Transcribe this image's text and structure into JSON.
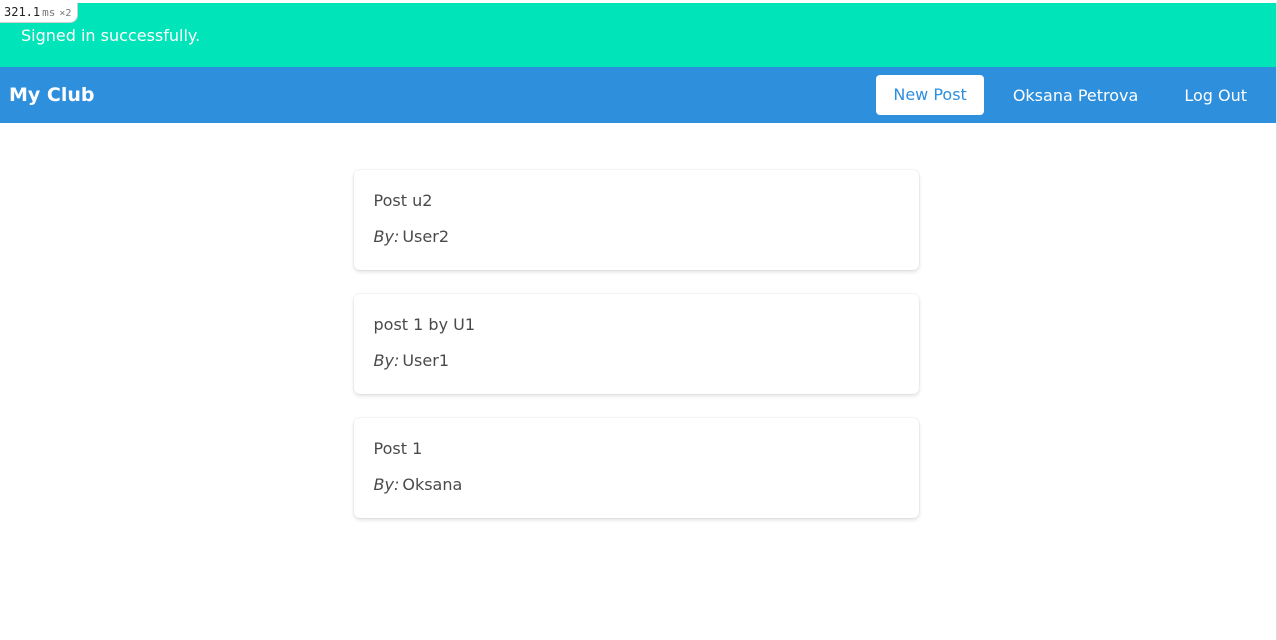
{
  "perf_badge": {
    "value": "321.1",
    "unit": "ms",
    "multiplier": "×2"
  },
  "flash": {
    "message": "Signed in successfully."
  },
  "navbar": {
    "brand": "My Club",
    "new_post_label": "New Post",
    "user_name": "Oksana Petrova",
    "logout_label": "Log Out"
  },
  "posts": [
    {
      "title": "Post u2",
      "by_label": "By:",
      "author": "User2"
    },
    {
      "title": "post 1 by U1",
      "by_label": "By:",
      "author": "User1"
    },
    {
      "title": "Post 1",
      "by_label": "By:",
      "author": "Oksana"
    }
  ],
  "colors": {
    "flash_bg": "#00e4b9",
    "navbar_bg": "#2e8fdd",
    "text": "#4a4a4a"
  }
}
